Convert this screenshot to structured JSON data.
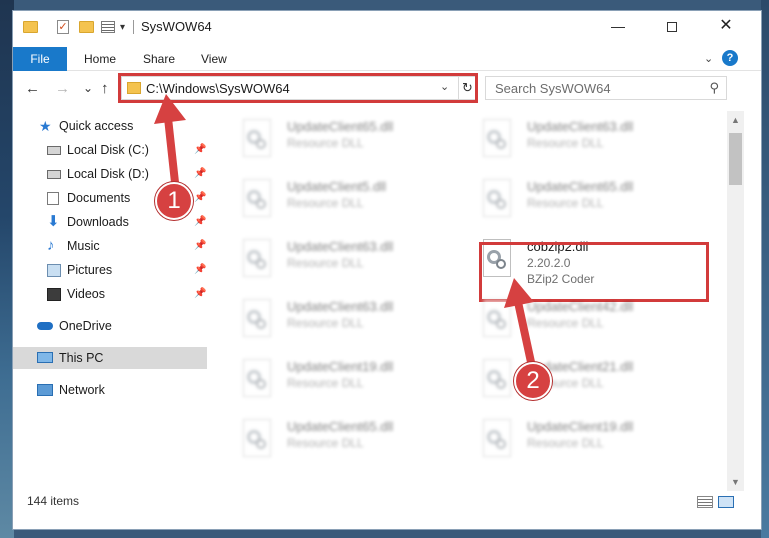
{
  "window": {
    "title": "SysWOW64",
    "controls": {
      "minimize": "—",
      "close": "✕"
    }
  },
  "ribbon": {
    "tabs": [
      "File",
      "Home",
      "Share",
      "View"
    ],
    "help": "?"
  },
  "navigation": {
    "back": "←",
    "forward": "→",
    "recent": "⌄",
    "up": "↑",
    "address": "C:\\Windows\\SysWOW64",
    "search_placeholder": "Search SysWOW64"
  },
  "sidebar": {
    "items": [
      {
        "label": "Quick access",
        "icon": "star-icon",
        "pinned": false
      },
      {
        "label": "Local Disk (C:)",
        "icon": "drive-icon",
        "pinned": true
      },
      {
        "label": "Local Disk (D:)",
        "icon": "drive-icon",
        "pinned": true
      },
      {
        "label": "Documents",
        "icon": "documents-icon",
        "pinned": true
      },
      {
        "label": "Downloads",
        "icon": "download-icon",
        "pinned": true
      },
      {
        "label": "Music",
        "icon": "music-icon",
        "pinned": true
      },
      {
        "label": "Pictures",
        "icon": "pictures-icon",
        "pinned": true
      },
      {
        "label": "Videos",
        "icon": "videos-icon",
        "pinned": true
      },
      {
        "label": "OneDrive",
        "icon": "cloud-icon",
        "pinned": false
      },
      {
        "label": "This PC",
        "icon": "computer-icon",
        "pinned": false,
        "selected": true
      },
      {
        "label": "Network",
        "icon": "network-icon",
        "pinned": false
      }
    ]
  },
  "files": [
    {
      "name": "UpdateClient65.dll",
      "line2": "Resource DLL",
      "line3": "",
      "blurred": true
    },
    {
      "name": "UpdateClient63.dll",
      "line2": "Resource DLL",
      "line3": "",
      "blurred": true
    },
    {
      "name": "UpdateClient5.dll",
      "line2": "Resource DLL",
      "line3": "",
      "blurred": true
    },
    {
      "name": "UpdateClient65.dll",
      "line2": "Resource DLL",
      "line3": "",
      "blurred": true
    },
    {
      "name": "UpdateClient63.dll",
      "line2": "Resource DLL",
      "line3": "",
      "blurred": true
    },
    {
      "name": "cobzip2.dll",
      "line2": "2.20.2.0",
      "line3": "BZip2 Coder",
      "blurred": false
    },
    {
      "name": "UpdateClient63.dll",
      "line2": "Resource DLL",
      "line3": "",
      "blurred": true
    },
    {
      "name": "UpdateClient42.dll",
      "line2": "Resource DLL",
      "line3": "",
      "blurred": true
    },
    {
      "name": "UpdateClient19.dll",
      "line2": "Resource DLL",
      "line3": "",
      "blurred": true
    },
    {
      "name": "UpdateClient21.dll",
      "line2": "Resource DLL",
      "line3": "",
      "blurred": true
    },
    {
      "name": "UpdateClient65.dll",
      "line2": "Resource DLL",
      "line3": "",
      "blurred": true
    },
    {
      "name": "UpdateClient19.dll",
      "line2": "Resource DLL",
      "line3": "",
      "blurred": true
    }
  ],
  "status": {
    "item_count": "144 items"
  },
  "annotations": {
    "step1": "1",
    "step2": "2",
    "highlight_color": "#d23b3b"
  }
}
